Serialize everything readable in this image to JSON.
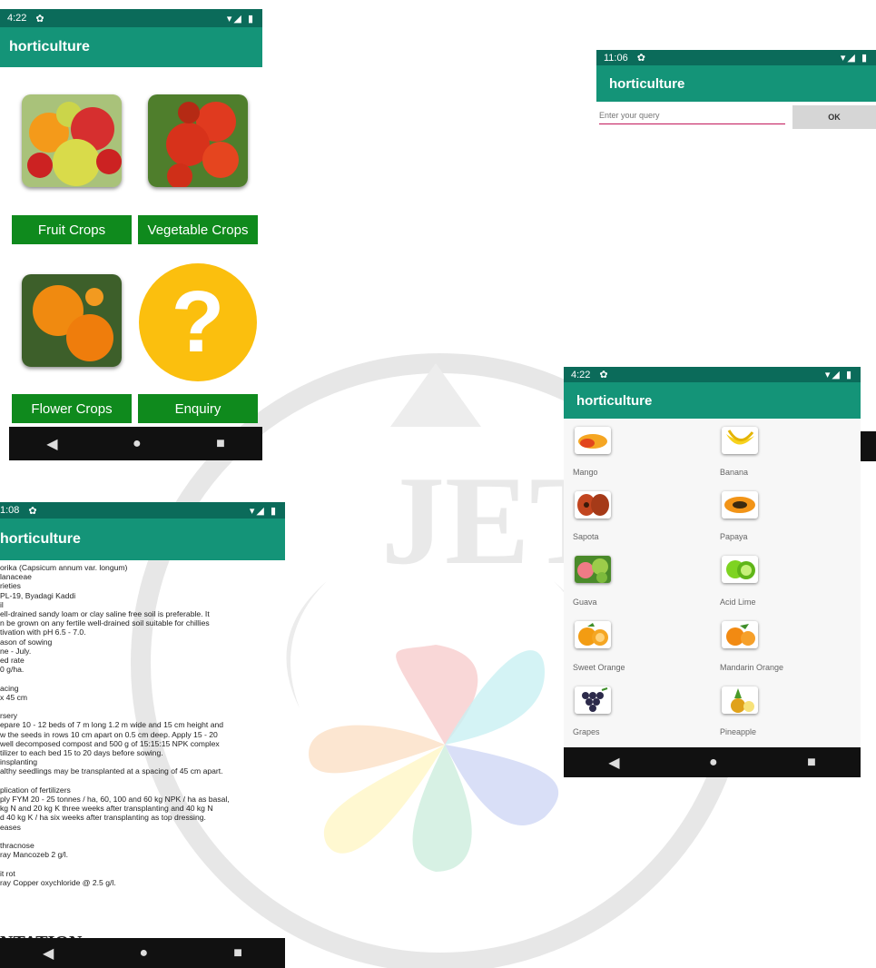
{
  "watermark": {
    "letters": "JETIR"
  },
  "screen_home": {
    "status_time": "4:22",
    "status_right": "▾◢ ▮",
    "app_title": "horticulture",
    "buttons": [
      "Fruit Crops",
      "Vegetable Crops",
      "Flower Crops",
      "Enquiry"
    ],
    "enquiry_symbol": "?"
  },
  "screen_query": {
    "status_time": "11:06",
    "status_right": "▾◢ ▮",
    "app_title": "horticulture",
    "input_placeholder": "Enter your query",
    "ok_label": "OK"
  },
  "screen_fruits": {
    "status_time": "4:22",
    "status_right": "▾◢ ▮",
    "app_title": "horticulture",
    "items": [
      "Mango",
      "Banana",
      "Sapota",
      "Papaya",
      "Guava",
      "Acid Lime",
      "Sweet Orange",
      "Mandarin Orange",
      "Grapes",
      "Pineapple"
    ]
  },
  "screen_detail": {
    "status_time": "1:08",
    "status_right": "▾◢ ▮",
    "app_title": "horticulture",
    "lines": [
      "orika (Capsicum annum var. longum)",
      "lanaceae",
      "rieties",
      "PL-19, Byadagi Kaddi",
      "il",
      "ell-drained sandy loam or clay saline free soil is preferable. It",
      "n be grown on any fertile well-drained soil suitable for chillies",
      "tivation with pH 6.5 - 7.0.",
      "ason of sowing",
      "ne - July.",
      "ed rate",
      "0 g/ha.",
      "",
      "acing",
      "x 45 cm",
      "",
      "rsery",
      "epare 10 - 12 beds of 7 m long 1.2 m wide and 15 cm height and",
      "w the seeds in rows 10 cm apart on 0.5 cm deep. Apply 15 - 20",
      "well decomposed compost and 500 g of 15:15:15 NPK complex",
      "tilizer to each bed 15 to 20 days before sowing.",
      "insplanting",
      "althy seedlings may be transplanted at a spacing of 45 cm apart.",
      "",
      "plication of fertilizers",
      "ply FYM 20 - 25 tonnes / ha, 60, 100 and 60 kg NPK / ha as basal,",
      "kg N and 20 kg K three weeks after transplanting and 40 kg N",
      "d 40 kg K / ha six weeks after transplanting as top dressing.",
      "eases",
      "",
      "thracnose",
      "ray Mancozeb 2 g/l.",
      "",
      "it rot",
      "ray Copper oxychloride @ 2.5 g/l."
    ],
    "partial_heading": "NTATION"
  },
  "nav_icons": {
    "back": "◀",
    "home": "●",
    "recent": "■"
  },
  "colors": {
    "status": "#0b6b5a",
    "appbar": "#149478",
    "button_green": "#0f8a1d",
    "input_underline": "#c2185b"
  }
}
